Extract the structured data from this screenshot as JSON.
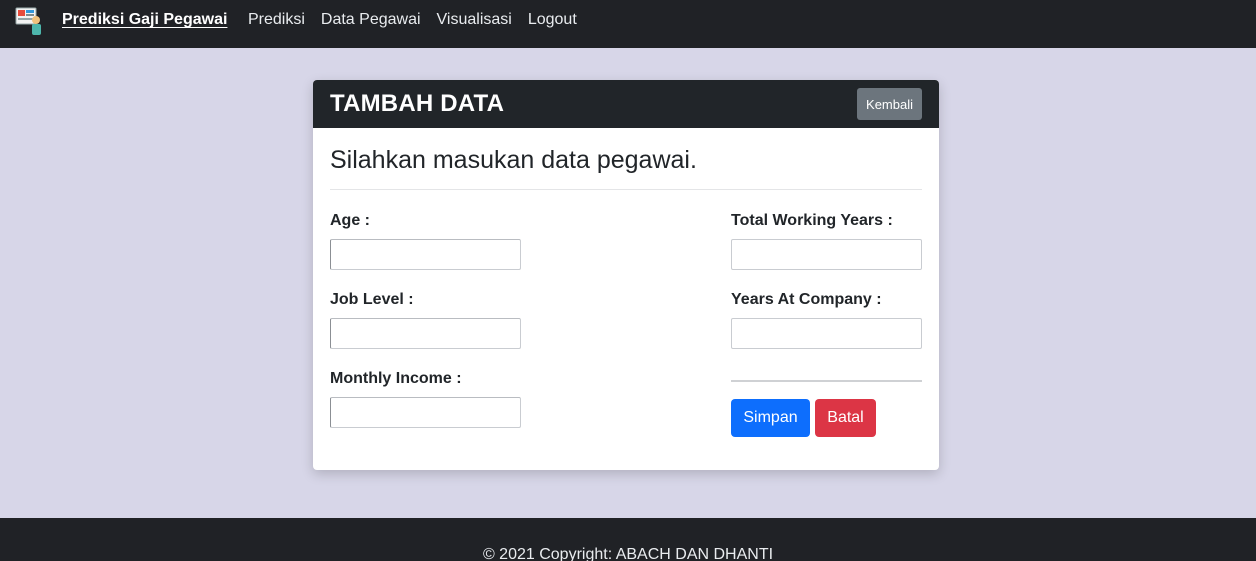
{
  "navbar": {
    "brand": "Prediksi Gaji Pegawai",
    "logo_icon": "app-logo-icon",
    "links": [
      "Prediksi",
      "Data Pegawai",
      "Visualisasi",
      "Logout"
    ]
  },
  "card": {
    "title": "TAMBAH DATA",
    "back_label": "Kembali",
    "intro": "Silahkan masukan data pegawai.",
    "fields": {
      "age": {
        "label": "Age :",
        "value": ""
      },
      "job_level": {
        "label": "Job Level :",
        "value": ""
      },
      "monthly_income": {
        "label": "Monthly Income :",
        "value": ""
      },
      "total_working_years": {
        "label": "Total Working Years :",
        "value": ""
      },
      "years_at_company": {
        "label": "Years At Company :",
        "value": ""
      }
    },
    "save_label": "Simpan",
    "cancel_label": "Batal"
  },
  "footer": {
    "copyright": "© 2021 Copyright: ABACH DAN DHANTI"
  },
  "colors": {
    "background": "#d7d6e8",
    "navbar": "#202226",
    "primary": "#0d6efd",
    "danger": "#dc3545",
    "secondary": "#6c757d"
  }
}
